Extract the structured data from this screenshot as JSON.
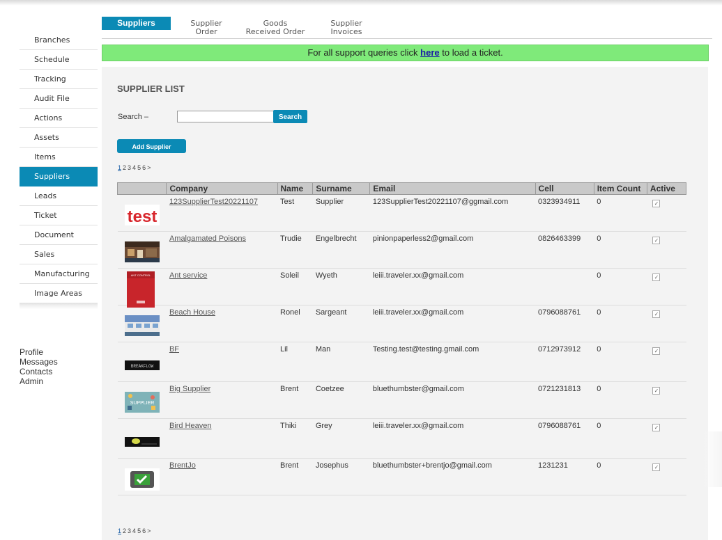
{
  "tabs": [
    {
      "label": "Suppliers",
      "active": true
    },
    {
      "label": "Supplier Order",
      "active": false
    },
    {
      "label": "Goods Received Order",
      "active": false
    },
    {
      "label": "Supplier Invoices",
      "active": false
    }
  ],
  "sidebar": {
    "items": [
      {
        "label": "Branches"
      },
      {
        "label": "Schedule"
      },
      {
        "label": "Tracking"
      },
      {
        "label": "Audit File"
      },
      {
        "label": "Actions"
      },
      {
        "label": "Assets"
      },
      {
        "label": "Items"
      },
      {
        "label": "Suppliers",
        "active": true
      },
      {
        "label": "Leads"
      },
      {
        "label": "Ticket"
      },
      {
        "label": "Document"
      },
      {
        "label": "Sales"
      },
      {
        "label": "Manufacturing"
      },
      {
        "label": "Image Areas"
      }
    ],
    "bottom_items": [
      {
        "label": "Profile"
      },
      {
        "label": "Messages"
      },
      {
        "label": "Contacts"
      },
      {
        "label": "Admin"
      }
    ]
  },
  "banner": {
    "prefix": "For all support queries click ",
    "link": "here",
    "suffix": " to load a ticket."
  },
  "main": {
    "title": "SUPPLIER LIST",
    "search_label": "Search –",
    "search_value": "",
    "search_button": "Search",
    "add_button": "Add Supplier",
    "pages": [
      "1",
      "2",
      "3",
      "4",
      "5",
      "6",
      ">"
    ],
    "current_page": "1",
    "columns": [
      "",
      "Company",
      "Name",
      "Surname",
      "Email",
      "Cell",
      "Item Count",
      "Active"
    ],
    "rows": [
      {
        "thumb": "test",
        "company": "123SupplierTest20221107",
        "name": "Test",
        "surname": "Supplier",
        "email": "123SupplierTest20221107@ggmail.com",
        "cell": "0323934911",
        "item_count": "0",
        "active": true
      },
      {
        "thumb": "shop",
        "company": "Amalgamated Poisons",
        "name": "Trudie",
        "surname": "Engelbrecht",
        "email": "pinionpaperless2@gmail.com",
        "cell": "0826463399",
        "item_count": "0",
        "active": true
      },
      {
        "thumb": "pest",
        "company": "Ant service",
        "name": "Soleil",
        "surname": "Wyeth",
        "email": "leiii.traveler.xx@gmail.com",
        "cell": "",
        "item_count": "0",
        "active": true
      },
      {
        "thumb": "house",
        "company": "Beach House",
        "name": "Ronel",
        "surname": "Sargeant",
        "email": "leiii.traveler.xx@gmail.com",
        "cell": "0796088761",
        "item_count": "0",
        "active": true
      },
      {
        "thumb": "bf",
        "company": "BF",
        "name": "Lil",
        "surname": "Man",
        "email": "Testing.test@testing.gmail.com",
        "cell": "0712973912",
        "item_count": "0",
        "active": true
      },
      {
        "thumb": "supplier",
        "company": "Big Supplier",
        "name": "Brent",
        "surname": "Coetzee",
        "email": "bluethumbster@gmail.com",
        "cell": "0721231813",
        "item_count": "0",
        "active": true
      },
      {
        "thumb": "bird",
        "company": "Bird Heaven",
        "name": "Thiki",
        "surname": "Grey",
        "email": "leiii.traveler.xx@gmail.com",
        "cell": "0796088761",
        "item_count": "0",
        "active": true
      },
      {
        "thumb": "check",
        "company": "BrentJo",
        "name": "Brent",
        "surname": "Josephus",
        "email": "bluethumbster+brentjo@gmail.com",
        "cell": "1231231",
        "item_count": "0",
        "active": true
      }
    ]
  },
  "colors": {
    "accent": "#0b8ab5",
    "banner": "#7fea7a",
    "panel": "#f3f3f3"
  }
}
